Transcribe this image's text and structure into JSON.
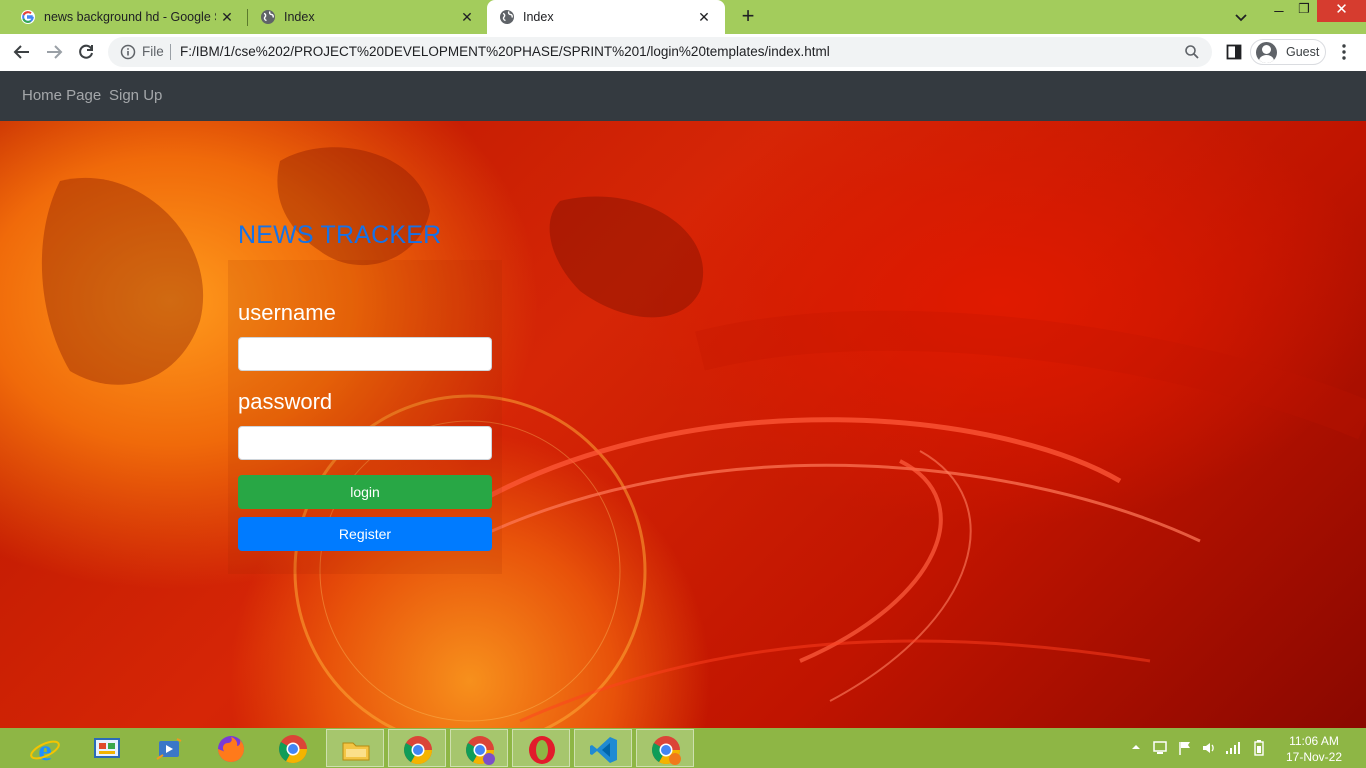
{
  "browser": {
    "tabs": [
      {
        "title": "news background hd - Google Se",
        "favicon": "google-g-icon"
      },
      {
        "title": "Index",
        "favicon": "globe-icon"
      },
      {
        "title": "Index",
        "favicon": "globe-icon",
        "active": true
      }
    ],
    "address": {
      "scheme_label": "File",
      "url": "F:/IBM/1/cse%202/PROJECT%20DEVELOPMENT%20PHASE/SPRINT%201/login%20templates/index.html"
    },
    "profile_label": "Guest"
  },
  "site_nav": {
    "home_label": "Home Page",
    "signup_label": "Sign Up"
  },
  "login": {
    "title": "NEWS TRACKER",
    "username_label": "username",
    "username_value": "",
    "password_label": "password",
    "password_value": "",
    "login_button": "login",
    "register_button": "Register"
  },
  "colors": {
    "title": "#1572e8",
    "login_button": "#28a745",
    "register_button": "#007bff",
    "navbar": "#343a40",
    "taskbar": "#8eb645"
  },
  "taskbar": {
    "apps": [
      "internet-explorer-icon",
      "control-panel-icon",
      "media-center-icon",
      "firefox-icon",
      "chrome-icon",
      "file-explorer-icon",
      "chrome-icon",
      "chrome-profile-m-icon",
      "opera-icon",
      "vscode-icon",
      "chrome-profile-n-icon"
    ],
    "time": "11:06 AM",
    "date": "17-Nov-22"
  }
}
